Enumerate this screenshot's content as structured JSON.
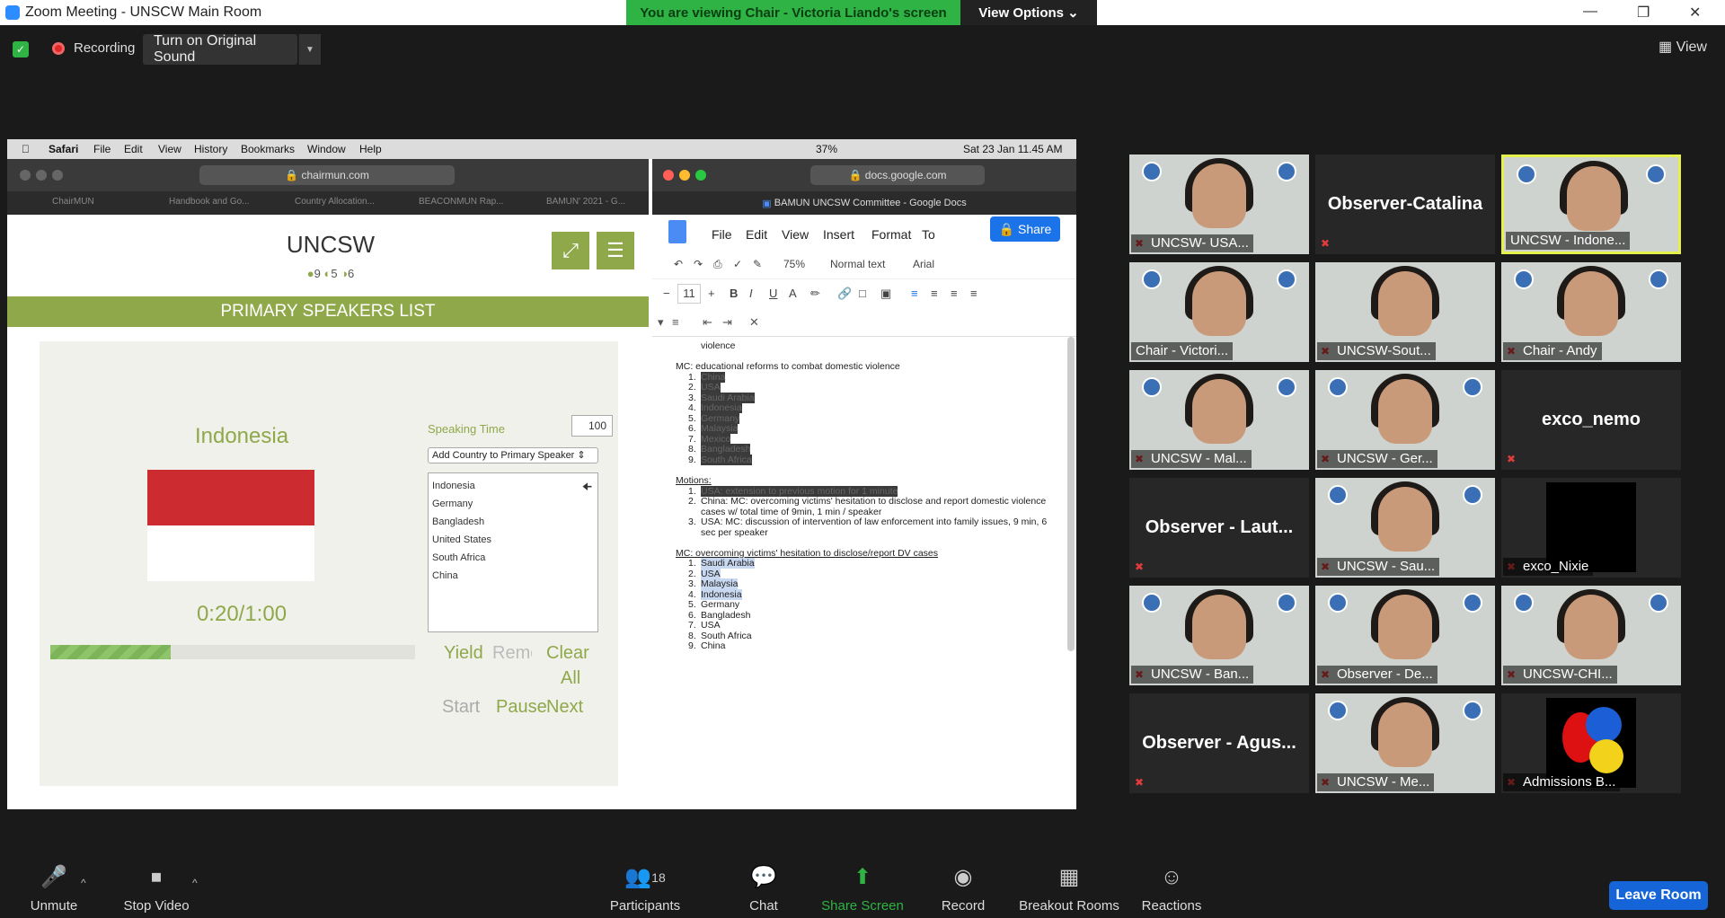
{
  "window": {
    "title": "Zoom Meeting - UNSCW Main Room",
    "banner": "You are viewing Chair - Victoria Liando's screen",
    "view_options": "View Options"
  },
  "toolbar": {
    "recording": "Recording",
    "original_sound": "Turn on Original Sound",
    "view": "View"
  },
  "mac": {
    "menu": [
      "Safari",
      "File",
      "Edit",
      "View",
      "History",
      "Bookmarks",
      "Window",
      "Help"
    ],
    "status": "37%",
    "datetime": "Sat 23 Jan  11.45 AM"
  },
  "safari_left": {
    "url": "chairmun.com",
    "tabs": [
      "ChairMUN",
      "Handbook and Go...",
      "Country Allocation...",
      "BEACONMUN Rap...",
      "BAMUN' 2021 - G..."
    ]
  },
  "chairmun": {
    "title": "UNCSW",
    "stats": [
      "9",
      "5",
      "6"
    ],
    "header": "PRIMARY SPEAKERS LIST",
    "country": "Indonesia",
    "timer": "0:20/1:00",
    "progress": 0.33,
    "speaking_time_label": "Speaking Time",
    "speaking_time": "100",
    "add_country": "Add Country to Primary Speaker",
    "speakers": [
      "Indonesia",
      "Germany",
      "Bangladesh",
      "United States",
      "South Africa",
      "China"
    ],
    "buttons": {
      "yield": "Yield",
      "remove": "Remove",
      "clear": "Clear",
      "all": "All",
      "start": "Start",
      "pause": "Pause",
      "next": "Next"
    },
    "colors": {
      "accent": "#8fa84a",
      "flag_red": "#cc2b2f"
    }
  },
  "safari_right": {
    "url": "docs.google.com",
    "tab": "BAMUN UNCSW Committee - Google Docs"
  },
  "docs": {
    "menu": [
      "File",
      "Edit",
      "View",
      "Insert",
      "Format",
      "To"
    ],
    "share": "Share",
    "zoom": "75%",
    "style": "Normal text",
    "font": "Arial",
    "font_size": "11",
    "lines": [
      {
        "t": "violence",
        "c": ""
      },
      {
        "t": "MC: educational reforms to combat domestic violence",
        "c": ""
      },
      {
        "n": "1.",
        "t": "China",
        "c": "hl"
      },
      {
        "n": "2.",
        "t": "USA",
        "c": "hl"
      },
      {
        "n": "3.",
        "t": "Saudi Arabia",
        "c": "hl"
      },
      {
        "n": "4.",
        "t": "Indonesia",
        "c": "hl"
      },
      {
        "n": "5.",
        "t": "Germany",
        "c": "hl"
      },
      {
        "n": "6.",
        "t": "Malaysia",
        "c": "hl"
      },
      {
        "n": "7.",
        "t": "Mexico",
        "c": "hl"
      },
      {
        "n": "8.",
        "t": "Bangladesh",
        "c": "hl"
      },
      {
        "n": "9.",
        "t": "South Africa",
        "c": "hl"
      },
      {
        "t": "Motions:",
        "c": "u"
      },
      {
        "n": "1.",
        "t": "USA: extension to previous motion for 1 minute",
        "c": "hl"
      },
      {
        "n": "2.",
        "t": "China: MC: overcoming victims' hesitation to disclose and report domestic violence",
        "c": ""
      },
      {
        "t": "cases w/ total time of 9min, 1 min / speaker",
        "c": ""
      },
      {
        "n": "3.",
        "t": "USA: MC: discussion of intervention of law enforcement into family issues, 9 min, 6",
        "c": ""
      },
      {
        "t": "sec per speaker",
        "c": ""
      },
      {
        "t": "MC: overcoming victims' hesitation to disclose/report DV cases",
        "c": "u"
      },
      {
        "n": "1.",
        "t": "Saudi Arabia",
        "c": "bl"
      },
      {
        "n": "2.",
        "t": "USA",
        "c": "bl"
      },
      {
        "n": "3.",
        "t": "Malaysia",
        "c": "bl"
      },
      {
        "n": "4.",
        "t": "Indonesia",
        "c": "bl"
      },
      {
        "n": "5.",
        "t": "Germany",
        "c": ""
      },
      {
        "n": "6.",
        "t": "Bangladesh",
        "c": ""
      },
      {
        "n": "7.",
        "t": "USA",
        "c": ""
      },
      {
        "n": "8.",
        "t": "South Africa",
        "c": ""
      },
      {
        "n": "9.",
        "t": "China",
        "c": ""
      }
    ]
  },
  "participants": [
    {
      "name": "UNCSW- USA...",
      "video": true,
      "muted": true
    },
    {
      "name": "",
      "label": "Observer-Catalina",
      "video": false,
      "muted": true
    },
    {
      "name": "UNCSW - Indone...",
      "video": true,
      "muted": false,
      "active": true
    },
    {
      "name": "Chair - Victori...",
      "video": true,
      "muted": false
    },
    {
      "name": "UNCSW-Sout...",
      "video": true,
      "muted": true
    },
    {
      "name": "Chair - Andy",
      "video": true,
      "muted": true
    },
    {
      "name": "UNCSW - Mal...",
      "video": true,
      "muted": true
    },
    {
      "name": "UNCSW - Ger...",
      "video": true,
      "muted": true
    },
    {
      "name": "",
      "label": "exco_nemo",
      "video": false,
      "muted": true
    },
    {
      "name": "",
      "label": "Observer - Laut...",
      "video": false,
      "muted": true
    },
    {
      "name": "UNCSW - Sau...",
      "video": true,
      "muted": true
    },
    {
      "name": "exco_Nixie",
      "video": false,
      "muted": true,
      "black": true
    },
    {
      "name": "UNCSW - Ban...",
      "video": true,
      "muted": true
    },
    {
      "name": "Observer - De...",
      "video": true,
      "muted": true
    },
    {
      "name": "UNCSW-CHI...",
      "video": true,
      "muted": true
    },
    {
      "name": "",
      "label": "Observer - Agus...",
      "video": false,
      "muted": true
    },
    {
      "name": "UNCSW - Me...",
      "video": true,
      "muted": true
    },
    {
      "name": "Admissions B...",
      "video": false,
      "muted": true,
      "logo": true
    }
  ],
  "bottom": {
    "unmute": "Unmute",
    "stop_video": "Stop Video",
    "participants": "Participants",
    "participants_count": "18",
    "chat": "Chat",
    "share_screen": "Share Screen",
    "record": "Record",
    "breakout": "Breakout Rooms",
    "reactions": "Reactions",
    "leave": "Leave Room"
  }
}
